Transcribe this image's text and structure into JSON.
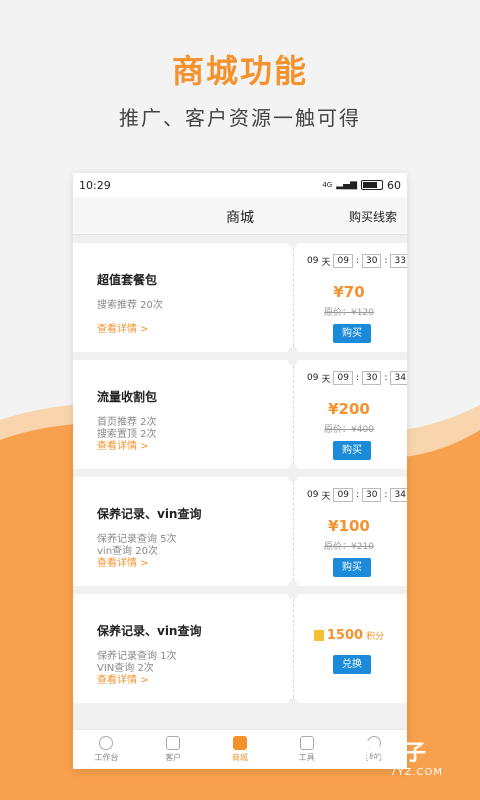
{
  "headline": "商城功能",
  "subline": "推广、客户资源一触可得",
  "status": {
    "time": "10:29",
    "signal": "4G",
    "battery": "60"
  },
  "nav": {
    "title": "商城",
    "action": "购买线索"
  },
  "cards": [
    {
      "title": "超值套餐包",
      "lines": [
        "搜索推荐 20次",
        ""
      ],
      "link": "查看详情 >",
      "countdown": {
        "days": "09",
        "day_label": "天",
        "h": "09",
        "m": "30",
        "s": "33"
      },
      "price": "¥70",
      "original": "原价：¥120",
      "button": "购买"
    },
    {
      "title": "流量收割包",
      "lines": [
        "首页推荐 2次",
        "搜索置顶 2次"
      ],
      "link": "查看详情 >",
      "countdown": {
        "days": "09",
        "day_label": "天",
        "h": "09",
        "m": "30",
        "s": "34"
      },
      "price": "¥200",
      "original": "原价：¥400",
      "button": "购买"
    },
    {
      "title": "保养记录、vin查询",
      "lines": [
        "保养记录查询 5次",
        "vin查询 20次"
      ],
      "link": "查看详情 >",
      "countdown": {
        "days": "09",
        "day_label": "天",
        "h": "09",
        "m": "30",
        "s": "34"
      },
      "price": "¥100",
      "original": "原价：¥210",
      "button": "购买"
    },
    {
      "title": "保养记录、vin查询",
      "lines": [
        "保养记录查询 1次",
        "VIN查询 2次"
      ],
      "link": "查看详情 >",
      "points": "1500",
      "points_unit": "积分",
      "button": "兑换"
    }
  ],
  "tabs": [
    {
      "label": "工作台",
      "icon": "dashboard-icon"
    },
    {
      "label": "客户",
      "icon": "clipboard-icon"
    },
    {
      "label": "商城",
      "icon": "shopping-bag-icon",
      "active": true
    },
    {
      "label": "工具",
      "icon": "toolbox-icon"
    },
    {
      "label": "我的",
      "icon": "person-icon"
    }
  ],
  "watermark": {
    "brand": "七叶子",
    "domain": "7YZ.COM"
  },
  "colors": {
    "accent": "#f5922d",
    "button": "#1b8ad8",
    "background": "#f3f3f3"
  }
}
